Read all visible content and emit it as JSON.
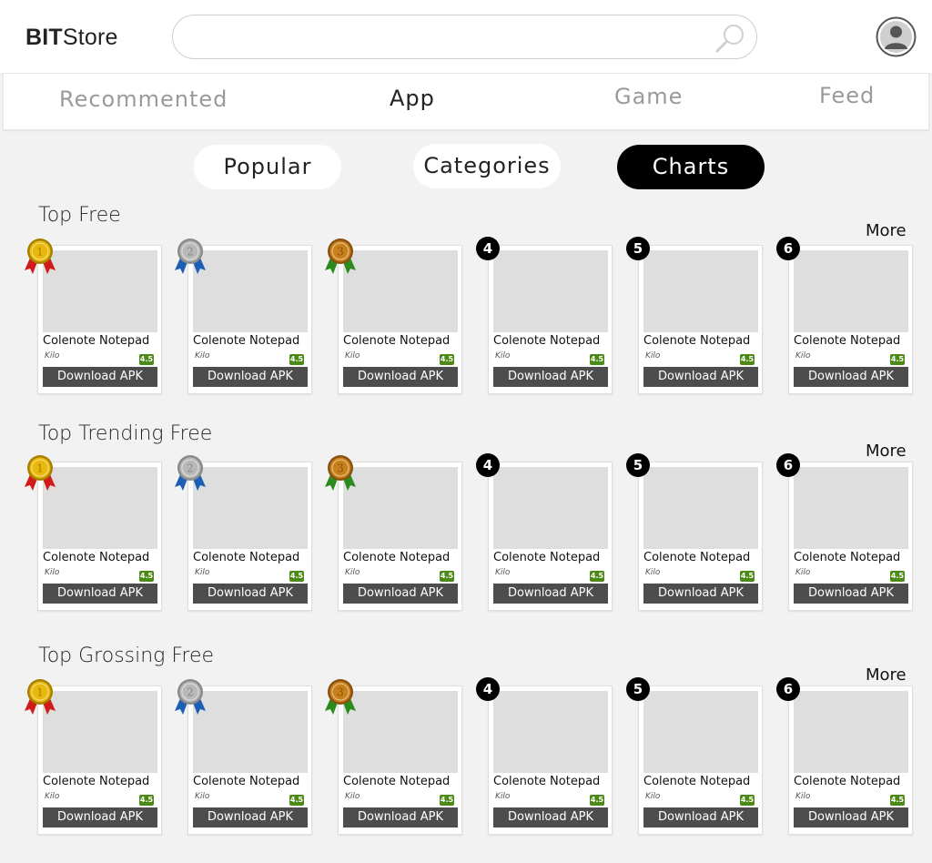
{
  "header": {
    "logo_bold": "BIT",
    "logo_rest": "Store",
    "search_value": "",
    "search_placeholder": ""
  },
  "main_tabs": [
    {
      "label": "Recommented",
      "active": false
    },
    {
      "label": "App",
      "active": true
    },
    {
      "label": "Game",
      "active": false
    },
    {
      "label": "Feed",
      "active": false
    }
  ],
  "sub_tabs": [
    {
      "label": "Popular",
      "active": false
    },
    {
      "label": "Categories",
      "active": false
    },
    {
      "label": "Charts",
      "active": true
    }
  ],
  "more_label": "More",
  "sections": [
    {
      "title": "Top Free",
      "apps": [
        {
          "rank": "1",
          "name": "Colenote Notepad",
          "developer": "Kilo",
          "rating": "4.5",
          "download_label": "Download APK"
        },
        {
          "rank": "2",
          "name": "Colenote Notepad",
          "developer": "Kilo",
          "rating": "4.5",
          "download_label": "Download APK"
        },
        {
          "rank": "3",
          "name": "Colenote Notepad",
          "developer": "Kilo",
          "rating": "4.5",
          "download_label": "Download APK"
        },
        {
          "rank": "4",
          "name": "Colenote Notepad",
          "developer": "Kilo",
          "rating": "4.5",
          "download_label": "Download APK"
        },
        {
          "rank": "5",
          "name": "Colenote Notepad",
          "developer": "Kilo",
          "rating": "4.5",
          "download_label": "Download APK"
        },
        {
          "rank": "6",
          "name": "Colenote Notepad",
          "developer": "Kilo",
          "rating": "4.5",
          "download_label": "Download APK"
        }
      ]
    },
    {
      "title": "Top Trending Free",
      "apps": [
        {
          "rank": "1",
          "name": "Colenote Notepad",
          "developer": "Kilo",
          "rating": "4.5",
          "download_label": "Download APK"
        },
        {
          "rank": "2",
          "name": "Colenote Notepad",
          "developer": "Kilo",
          "rating": "4.5",
          "download_label": "Download APK"
        },
        {
          "rank": "3",
          "name": "Colenote Notepad",
          "developer": "Kilo",
          "rating": "4.5",
          "download_label": "Download APK"
        },
        {
          "rank": "4",
          "name": "Colenote Notepad",
          "developer": "Kilo",
          "rating": "4.5",
          "download_label": "Download APK"
        },
        {
          "rank": "5",
          "name": "Colenote Notepad",
          "developer": "Kilo",
          "rating": "4.5",
          "download_label": "Download APK"
        },
        {
          "rank": "6",
          "name": "Colenote Notepad",
          "developer": "Kilo",
          "rating": "4.5",
          "download_label": "Download APK"
        }
      ]
    },
    {
      "title": "Top Grossing Free",
      "apps": [
        {
          "rank": "1",
          "name": "Colenote Notepad",
          "developer": "Kilo",
          "rating": "4.5",
          "download_label": "Download APK"
        },
        {
          "rank": "2",
          "name": "Colenote Notepad",
          "developer": "Kilo",
          "rating": "4.5",
          "download_label": "Download APK"
        },
        {
          "rank": "3",
          "name": "Colenote Notepad",
          "developer": "Kilo",
          "rating": "4.5",
          "download_label": "Download APK"
        },
        {
          "rank": "4",
          "name": "Colenote Notepad",
          "developer": "Kilo",
          "rating": "4.5",
          "download_label": "Download APK"
        },
        {
          "rank": "5",
          "name": "Colenote Notepad",
          "developer": "Kilo",
          "rating": "4.5",
          "download_label": "Download APK"
        },
        {
          "rank": "6",
          "name": "Colenote Notepad",
          "developer": "Kilo",
          "rating": "4.5",
          "download_label": "Download APK"
        }
      ]
    }
  ],
  "colors": {
    "rating_badge": "#4b8a15",
    "download_button": "#4d4d4d",
    "active_pill": "#000000",
    "medal_gold": "#e8b90c",
    "medal_silver": "#b8b8b8",
    "medal_bronze": "#c8801a",
    "ribbon_red": "#d11a1a",
    "ribbon_blue": "#1d5fb5",
    "ribbon_green": "#2c8a1f"
  },
  "icons": {
    "search": "search-icon",
    "avatar": "user-avatar-icon",
    "medal": "medal-icon"
  }
}
